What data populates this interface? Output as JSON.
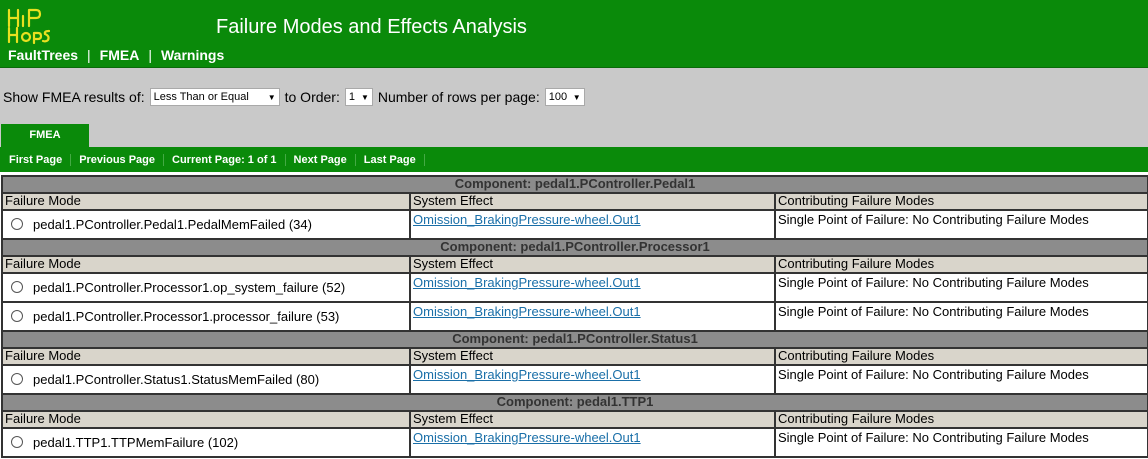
{
  "header": {
    "title": "Failure Modes and Effects Analysis",
    "logo_text": "HiP-HOPS",
    "brand_color": "#0a8a0a",
    "logo_color": "#e8e020"
  },
  "nav": {
    "items": [
      "FaultTrees",
      "FMEA",
      "Warnings"
    ],
    "separator": "|"
  },
  "options": {
    "show_label": "Show FMEA results of:",
    "filter_value": "Less Than or Equal",
    "order_label": "to Order:",
    "order_value": "1",
    "rows_label": "Number of rows per page:",
    "rows_value": "100"
  },
  "tab": {
    "label": "FMEA"
  },
  "pager": {
    "first": "First Page",
    "previous": "Previous Page",
    "current": "Current Page: 1 of 1",
    "next": "Next Page",
    "last": "Last Page"
  },
  "table": {
    "columns": [
      "Failure Mode",
      "System Effect",
      "Contributing Failure Modes"
    ],
    "components": [
      {
        "title": "Component: pedal1.PController.Pedal1",
        "rows": [
          {
            "failure_mode": "pedal1.PController.Pedal1.PedalMemFailed (34)",
            "effect": "Omission_BrakingPressure-wheel.Out1",
            "contributing": "Single Point of Failure: No Contributing Failure Modes"
          }
        ]
      },
      {
        "title": "Component: pedal1.PController.Processor1",
        "rows": [
          {
            "failure_mode": "pedal1.PController.Processor1.op_system_failure (52)",
            "effect": "Omission_BrakingPressure-wheel.Out1",
            "contributing": "Single Point of Failure: No Contributing Failure Modes"
          },
          {
            "failure_mode": "pedal1.PController.Processor1.processor_failure (53)",
            "effect": "Omission_BrakingPressure-wheel.Out1",
            "contributing": "Single Point of Failure: No Contributing Failure Modes"
          }
        ]
      },
      {
        "title": "Component: pedal1.PController.Status1",
        "rows": [
          {
            "failure_mode": "pedal1.PController.Status1.StatusMemFailed (80)",
            "effect": "Omission_BrakingPressure-wheel.Out1",
            "contributing": "Single Point of Failure: No Contributing Failure Modes"
          }
        ]
      },
      {
        "title": "Component: pedal1.TTP1",
        "rows": [
          {
            "failure_mode": "pedal1.TTP1.TTPMemFailure (102)",
            "effect": "Omission_BrakingPressure-wheel.Out1",
            "contributing": "Single Point of Failure: No Contributing Failure Modes"
          }
        ]
      }
    ]
  }
}
